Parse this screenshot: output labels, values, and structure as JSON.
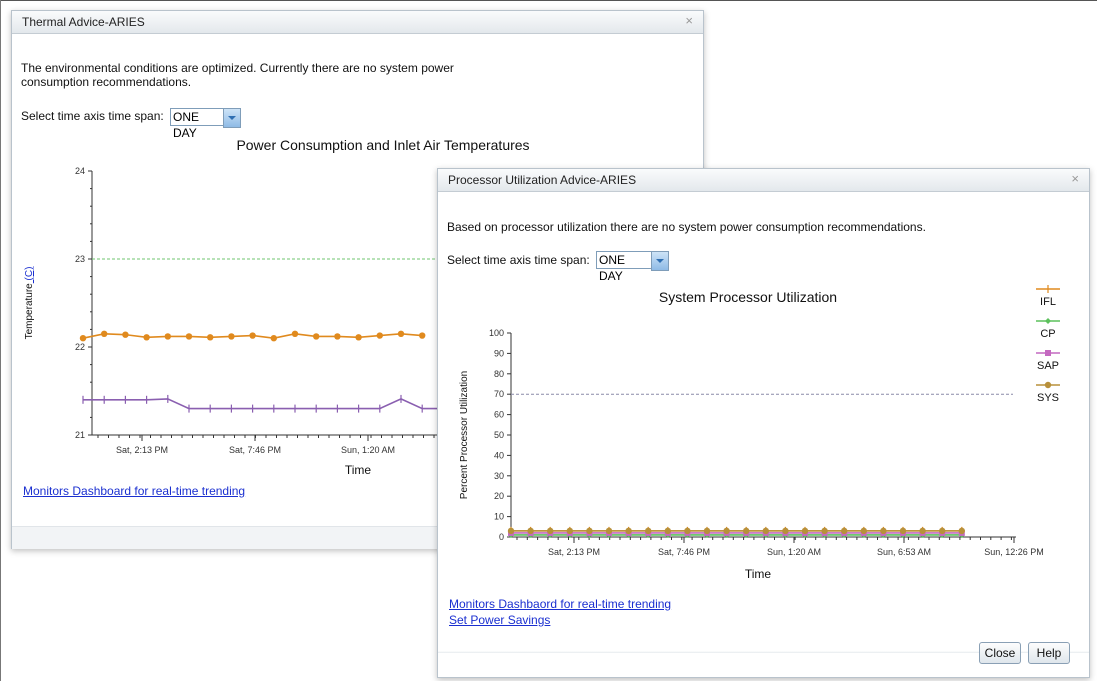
{
  "thermal": {
    "title": "Thermal Advice-ARIES",
    "close_glyph": "×",
    "message": "The environmental conditions are optimized. Currently there are no system power consumption recommendations.",
    "timespan_label": "Select time axis time span:",
    "timespan_value": "ONE DAY",
    "link": "Monitors Dashboard for real-time trending"
  },
  "processor": {
    "title": "Processor Utilization Advice-ARIES",
    "close_glyph": "×",
    "message": "Based on processor utilization there are no system power consumption recommendations.",
    "timespan_label": "Select time axis time span:",
    "timespan_value": "ONE DAY",
    "link_dashboard": "Monitors Dashbaord for real-time trending",
    "link_power": "Set Power Savings",
    "close_button": "Close",
    "help_button": "Help"
  },
  "chart_data": [
    {
      "type": "line",
      "title": "Power Consumption and Inlet Air Temperatures",
      "xlabel": "Time",
      "ylabel": "Temperature",
      "ylabel_unit_link": "C",
      "ylim": [
        21,
        24
      ],
      "yticks": [
        "24",
        "23",
        "22",
        "21"
      ],
      "xticks": [
        "Sat, 2:13 PM",
        "Sat, 7:46 PM",
        "Sun, 1:20 AM"
      ],
      "threshold": 23,
      "series": [
        {
          "color": "#e08a1e",
          "marker": "circle",
          "values": [
            22.1,
            22.15,
            22.14,
            22.11,
            22.12,
            22.12,
            22.11,
            22.12,
            22.13,
            22.1,
            22.15,
            22.12,
            22.12,
            22.11,
            22.13,
            22.15,
            22.13
          ]
        },
        {
          "color": "#8a5fb0",
          "marker": "plus",
          "values": [
            21.4,
            21.4,
            21.4,
            21.4,
            21.41,
            21.3,
            21.3,
            21.3,
            21.3,
            21.3,
            21.3,
            21.3,
            21.3,
            21.3,
            21.3,
            21.41,
            21.3,
            21.3,
            21.3,
            21.3
          ]
        }
      ]
    },
    {
      "type": "line",
      "title": "System Processor Utilization",
      "xlabel": "Time",
      "ylabel": "Percent Processor Utilization",
      "ylim": [
        0,
        100
      ],
      "yticks": [
        "100",
        "90",
        "80",
        "70",
        "60",
        "50",
        "40",
        "30",
        "20",
        "10",
        "0"
      ],
      "xticks": [
        "Sat, 2:13 PM",
        "Sat, 7:46 PM",
        "Sun, 1:20 AM",
        "Sun, 6:53 AM",
        "Sun, 12:26 PM"
      ],
      "threshold": 70,
      "legend_position": "right",
      "series": [
        {
          "name": "IFL",
          "color": "#e08a1e",
          "marker": "plus",
          "values": [
            3,
            3,
            3,
            3,
            3,
            3,
            3,
            3,
            3,
            3,
            3,
            3,
            3,
            3,
            3,
            3,
            3,
            3,
            3,
            3,
            3,
            3,
            3,
            3
          ]
        },
        {
          "name": "CP",
          "color": "#5cc15c",
          "marker": "diamond",
          "values": [
            1,
            1,
            1,
            1,
            1,
            1,
            1,
            1,
            1,
            1,
            1,
            1,
            1,
            1,
            1,
            1,
            1,
            1,
            1,
            1,
            1,
            1,
            1,
            1
          ]
        },
        {
          "name": "SAP",
          "color": "#c469c0",
          "marker": "square",
          "values": [
            2,
            2,
            2,
            2,
            2,
            2,
            2,
            2,
            2,
            2,
            2,
            2,
            2,
            2,
            2,
            2,
            2,
            2,
            2,
            2,
            2,
            2,
            2,
            2
          ]
        },
        {
          "name": "SYS",
          "color": "#b8903a",
          "marker": "circle",
          "values": [
            3,
            3,
            3,
            3,
            3,
            3,
            3,
            3,
            3,
            3,
            3,
            3,
            3,
            3,
            3,
            3,
            3,
            3,
            3,
            3,
            3,
            3,
            3,
            3
          ]
        }
      ]
    }
  ]
}
